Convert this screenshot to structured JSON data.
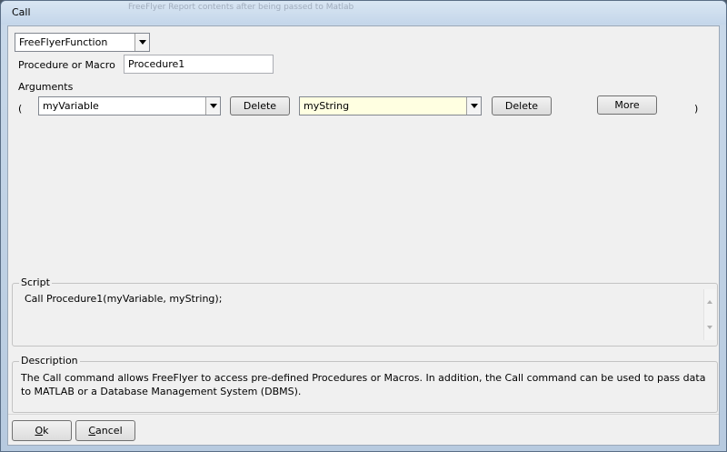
{
  "window": {
    "title": "Call",
    "background_text": [
      "FreeFlyer Report contents after being passed to Matlab"
    ]
  },
  "form": {
    "function_type": "FreeFlyerFunction",
    "procedure_label": "Procedure or Macro",
    "procedure_value": "Procedure1",
    "arguments_label": "Arguments",
    "open_paren": "(",
    "close_paren": ")",
    "arguments": [
      {
        "value": "myVariable",
        "delete_label": "Delete"
      },
      {
        "value": "myString",
        "delete_label": "Delete"
      }
    ],
    "more_label": "More"
  },
  "script": {
    "title": "Script",
    "text": "Call Procedure1(myVariable, myString);"
  },
  "description": {
    "title": "Description",
    "text": "The Call command allows FreeFlyer to access pre-defined Procedures or Macros. In addition, the Call command can be used to pass data to MATLAB or a Database Management System (DBMS)."
  },
  "footer": {
    "ok_accel": "O",
    "ok_rest": "k",
    "cancel_accel": "C",
    "cancel_rest": "ancel"
  },
  "colors": {
    "highlight_field": "#ffffe1",
    "dialog_bg": "#f0f0f0"
  }
}
